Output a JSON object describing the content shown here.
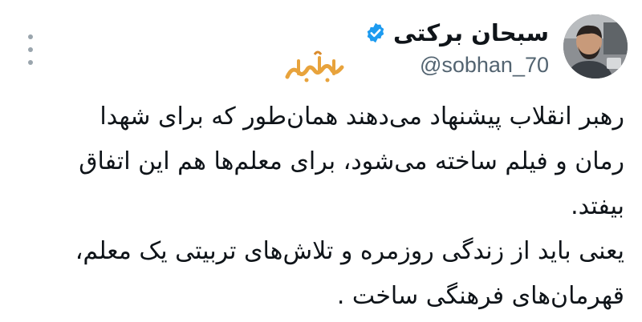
{
  "author": {
    "display_name": "سبحان برکتی",
    "handle": "@sobhan_70",
    "verified_color": "#1d9bf0"
  },
  "watermark": {
    "text": "خط رهبری",
    "color": "#e8a33c"
  },
  "icons": {
    "more": "more-vertical-icon",
    "verified": "verified-badge-icon"
  },
  "tweet": {
    "lines": [
      "رهبر انقلاب پیشنهاد می‌دهند همان‌طور که برای شهدا",
      "رمان و فیلم ساخته می‌شود، برای معلم‌ها هم این اتفاق",
      "بیفتد.",
      "یعنی باید از زندگی روزمره و تلاش‌های تربیتی یک معلم،",
      "قهرمان‌های فرهنگی ساخت ."
    ]
  }
}
